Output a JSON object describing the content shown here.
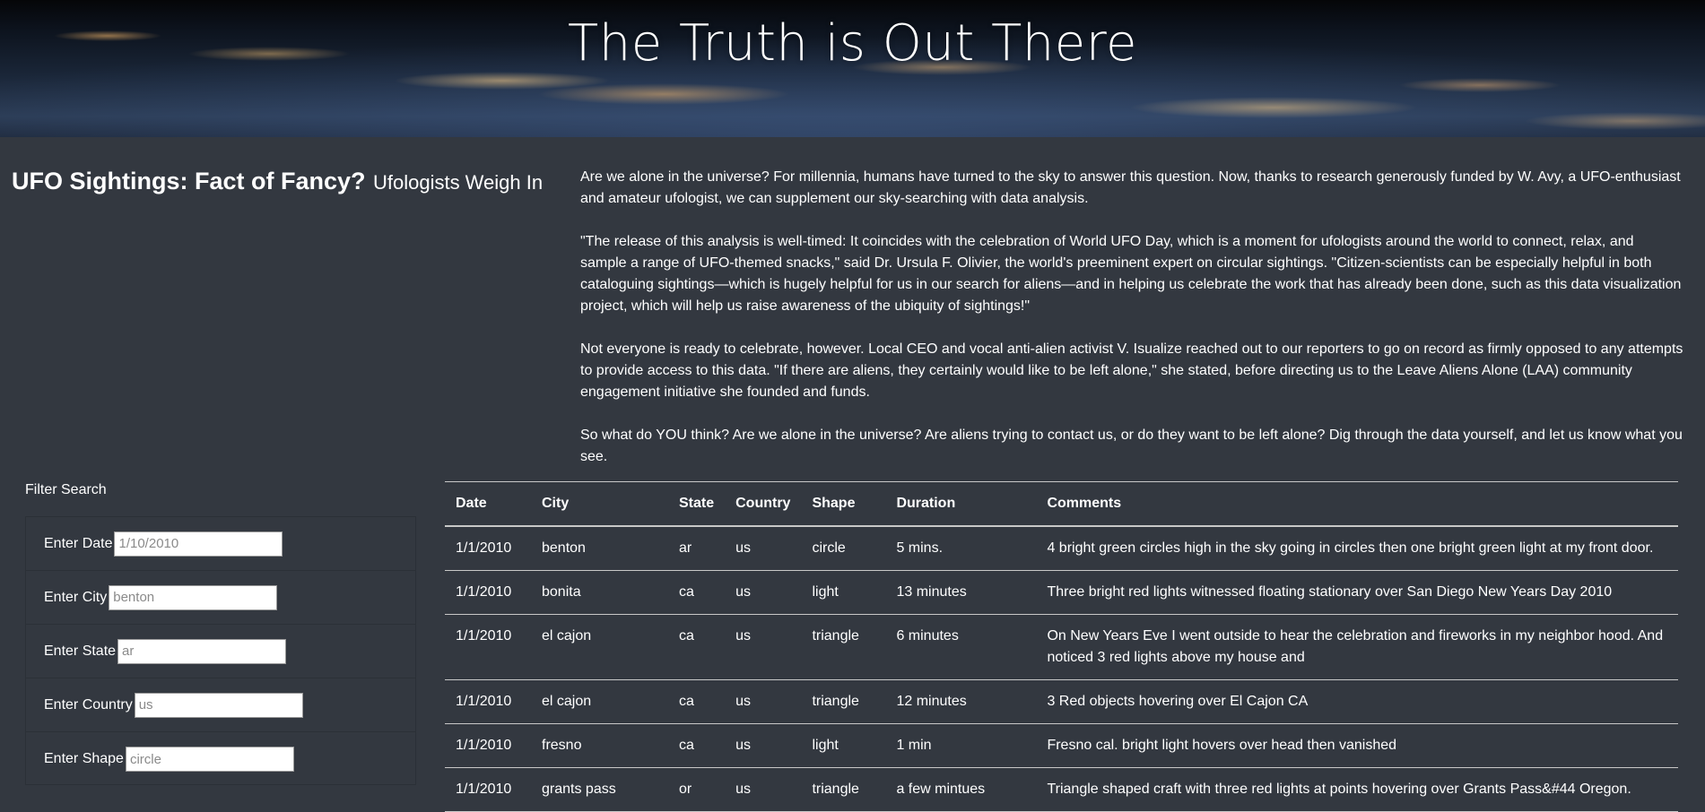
{
  "hero": {
    "title": "The Truth is Out There"
  },
  "heading": {
    "main": "UFO Sightings: Fact of Fancy?",
    "sub": "Ufologists Weigh In"
  },
  "article": {
    "paragraphs": [
      "Are we alone in the universe? For millennia, humans have turned to the sky to answer this question. Now, thanks to research generously funded by W. Avy, a UFO-enthusiast and amateur ufologist, we can supplement our sky-searching with data analysis.",
      "\"The release of this analysis is well-timed: It coincides with the celebration of World UFO Day, which is a moment for ufologists around the world to connect, relax, and sample a range of UFO-themed snacks,\" said Dr. Ursula F. Olivier, the world's preeminent expert on circular sightings. \"Citizen-scientists can be especially helpful in both cataloguing sightings—which is hugely helpful for us in our search for aliens—and in helping us celebrate the work that has already been done, such as this data visualization project, which will help us raise awareness of the ubiquity of sightings!\"",
      "Not everyone is ready to celebrate, however. Local CEO and vocal anti-alien activist V. Isualize reached out to our reporters to go on record as firmly opposed to any attempts to provide access to this data. \"If there are aliens, they certainly would like to be left alone,\" she stated, before directing us to the Leave Aliens Alone (LAA) community engagement initiative she founded and funds.",
      "So what do YOU think? Are we alone in the universe? Are aliens trying to contact us, or do they want to be left alone? Dig through the data yourself, and let us know what you see."
    ]
  },
  "filters": {
    "title": "Filter Search",
    "fields": [
      {
        "label": "Enter Date",
        "placeholder": "1/10/2010"
      },
      {
        "label": "Enter City",
        "placeholder": "benton"
      },
      {
        "label": "Enter State",
        "placeholder": "ar"
      },
      {
        "label": "Enter Country",
        "placeholder": "us"
      },
      {
        "label": "Enter Shape",
        "placeholder": "circle"
      }
    ]
  },
  "table": {
    "headers": [
      "Date",
      "City",
      "State",
      "Country",
      "Shape",
      "Duration",
      "Comments"
    ],
    "rows": [
      [
        "1/1/2010",
        "benton",
        "ar",
        "us",
        "circle",
        "5 mins.",
        "4 bright green circles high in the sky going in circles then one bright green light at my front door."
      ],
      [
        "1/1/2010",
        "bonita",
        "ca",
        "us",
        "light",
        "13 minutes",
        "Three bright red lights witnessed floating stationary over San Diego New Years Day 2010"
      ],
      [
        "1/1/2010",
        "el cajon",
        "ca",
        "us",
        "triangle",
        "6 minutes",
        "On New Years Eve I went outside to hear the celebration and fireworks in my neighbor hood. And noticed 3 red lights above my house and"
      ],
      [
        "1/1/2010",
        "el cajon",
        "ca",
        "us",
        "triangle",
        "12 minutes",
        "3 Red objects hovering over El Cajon CA"
      ],
      [
        "1/1/2010",
        "fresno",
        "ca",
        "us",
        "light",
        "1 min",
        "Fresno cal. bright light hovers over head then vanished"
      ],
      [
        "1/1/2010",
        "grants pass",
        "or",
        "us",
        "triangle",
        "a few mintues",
        "Triangle shaped craft with three red lights at points hovering over Grants Pass&#44 Oregon."
      ]
    ]
  }
}
